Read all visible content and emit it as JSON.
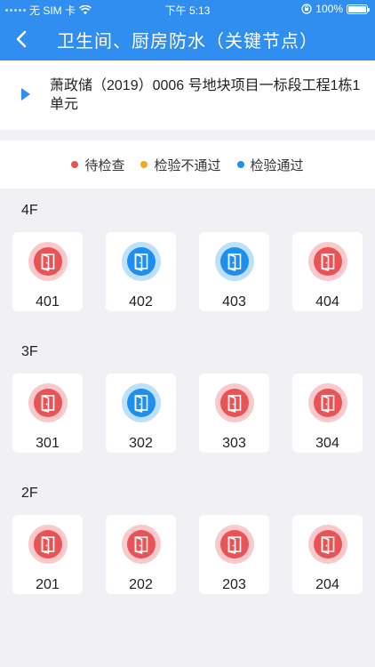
{
  "status_bar": {
    "carrier": "无 SIM 卡",
    "time": "下午 5:13",
    "battery": "100%"
  },
  "header": {
    "title": "卫生间、厨房防水（关键节点）",
    "back_icon": "chevron-left-icon"
  },
  "project": {
    "name": "萧政储（2019）0006 号地块项目一标段工程1栋1单元"
  },
  "legend": [
    {
      "label": "待检查",
      "color": "#e95356"
    },
    {
      "label": "检验不通过",
      "color": "#f5a623"
    },
    {
      "label": "检验通过",
      "color": "#1e8ef0"
    }
  ],
  "floors": [
    {
      "label": "4F",
      "rooms": [
        {
          "number": "401",
          "status": "pending"
        },
        {
          "number": "402",
          "status": "passed"
        },
        {
          "number": "403",
          "status": "passed"
        },
        {
          "number": "404",
          "status": "pending"
        }
      ]
    },
    {
      "label": "3F",
      "rooms": [
        {
          "number": "301",
          "status": "pending"
        },
        {
          "number": "302",
          "status": "passed"
        },
        {
          "number": "303",
          "status": "pending"
        },
        {
          "number": "304",
          "status": "pending"
        }
      ]
    },
    {
      "label": "2F",
      "rooms": [
        {
          "number": "201",
          "status": "pending"
        },
        {
          "number": "202",
          "status": "pending"
        },
        {
          "number": "203",
          "status": "pending"
        },
        {
          "number": "204",
          "status": "pending"
        }
      ]
    }
  ]
}
